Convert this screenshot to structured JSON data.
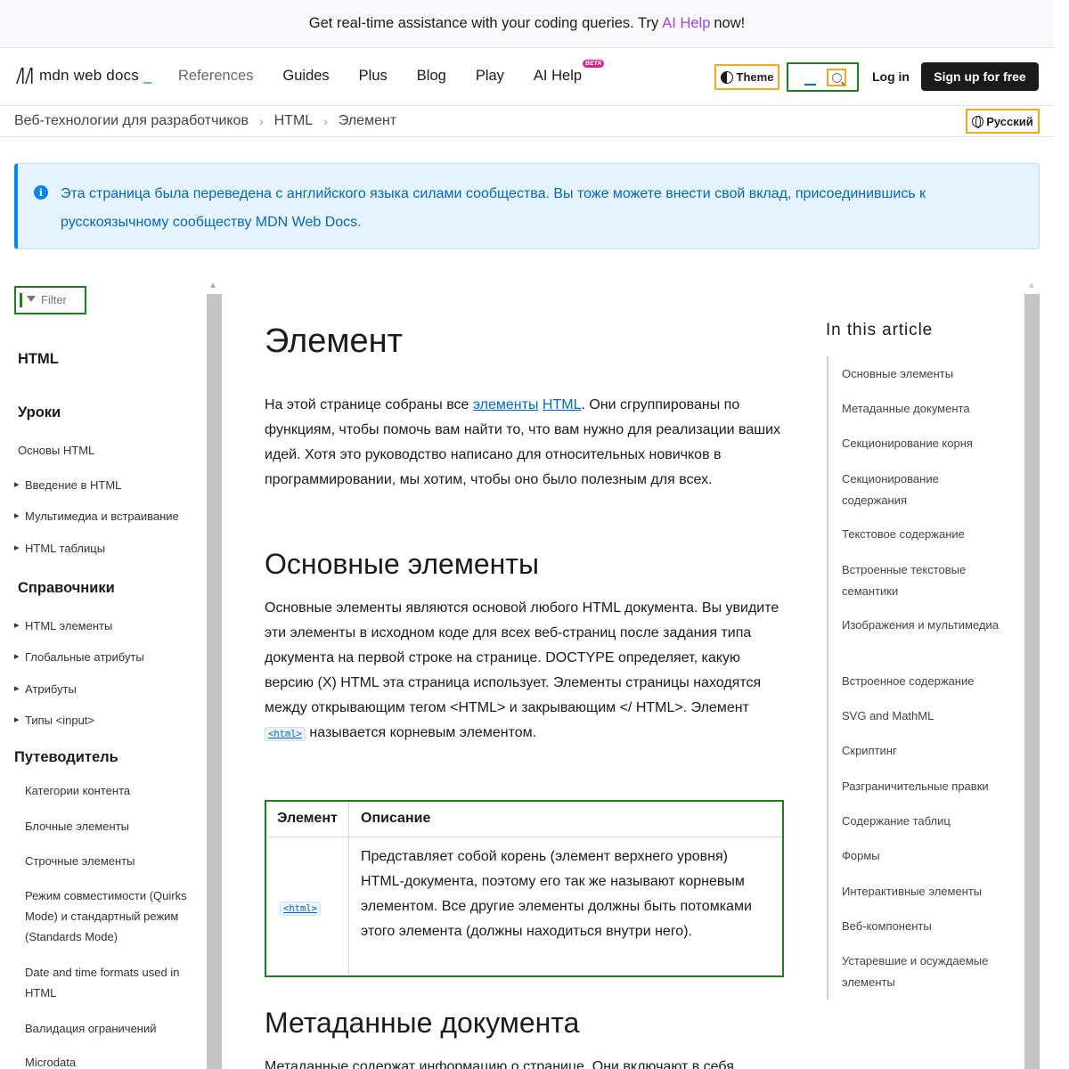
{
  "banner": {
    "text_before": "Get real-time assistance with your coding queries. Try",
    "ai_link": "AI Help",
    "text_after": "now!"
  },
  "header": {
    "logo_text": "mdn web docs",
    "nav": [
      "References",
      "Guides",
      "Plus",
      "Blog",
      "Play",
      "AI Help"
    ],
    "beta_badge": "BETA",
    "theme_label": "Theme",
    "login_label": "Log in",
    "signup_label": "Sign up for free"
  },
  "breadcrumb": {
    "items": [
      "Веб-технологии для разработчиков",
      "HTML",
      "Элемент"
    ],
    "language": "Русский"
  },
  "notice": {
    "text": "Эта страница была переведена с английского языка силами сообщества. Вы тоже можете внести свой вклад, присоединившись к русскоязычному сообществу MDN Web Docs."
  },
  "sidebar": {
    "filter_placeholder": "Filter",
    "title": "HTML",
    "sections": [
      {
        "heading": "Уроки",
        "items": [
          "Основы HTML",
          "Введение в HTML",
          "Мультимедиа и встраивание",
          "HTML таблицы"
        ]
      },
      {
        "heading": "Справочники",
        "items": [
          "HTML элементы",
          "Глобальные атрибуты",
          "Атрибуты",
          "Типы <input>"
        ]
      },
      {
        "heading": "Путеводитель",
        "items": [
          "Категории контента",
          "Блочные элементы",
          "Строчные элементы",
          "Режим совместимости (Quirks Mode) и стандартный режим (Standards Mode)",
          "Date and time formats used in HTML",
          "Валидация ограничений",
          "Microdata"
        ]
      }
    ]
  },
  "main": {
    "title": "Элемент",
    "intro_before": "На этой странице собраны все",
    "intro_link1": "элементы",
    "intro_link2": "HTML",
    "intro_after": ". Они сгруппированы по функциям, чтобы помочь вам найти то, что вам нужно для реализации ваших идей. Хотя это руководство написано для относительных новичков в программировании, мы хотим, чтобы оно было полезным для всех.",
    "section1_title": "Основные элементы",
    "section1_before": "Основные элементы являются основой любого HTML документа. Вы увидите эти элементы в исходном коде для всех веб-страниц после задания типа документа на первой строке на странице. DOCTYPE определяет, какую версию (X) HTML эта страница использует. Элементы страницы находятся между открывающим тегом <HTML> и закрывающим </ HTML>. Элемент",
    "section1_code": "<html>",
    "section1_after": "называется корневым элементом.",
    "table": {
      "headers": [
        "Элемент",
        "Описание"
      ],
      "rows": [
        {
          "element": "<html>",
          "description": "Представляет собой корень (элемент верхнего уровня) HTML-документа, поэтому его так же называют корневым элементом. Все другие элементы должны быть потомками этого элемента (должны находиться внутри него)."
        }
      ]
    },
    "section2_title": "Метаданные документа",
    "section2_partial": "Метаданные содержат информацию о странице. Они включают в себя"
  },
  "toc": {
    "title": "In this article",
    "items": [
      "Основные элементы",
      "Метаданные документа",
      "Секционирование корня",
      "Секционирование содержания",
      "Текстовое содержание",
      "Встроенные текстовые семантики",
      "Изображения и мультимедиа",
      "Встроенное содержание",
      "SVG and MathML",
      "Скриптинг",
      "Разграничительные правки",
      "Содержание таблиц",
      "Формы",
      "Интерактивные элементы",
      "Веб-компоненты",
      "Устаревшие и осуждаемые элементы"
    ]
  },
  "colors": {
    "accent": "#0069c2",
    "ai": "#9e44dc",
    "highlight_orange": "#f5a623",
    "highlight_green": "#1e7e1e"
  }
}
